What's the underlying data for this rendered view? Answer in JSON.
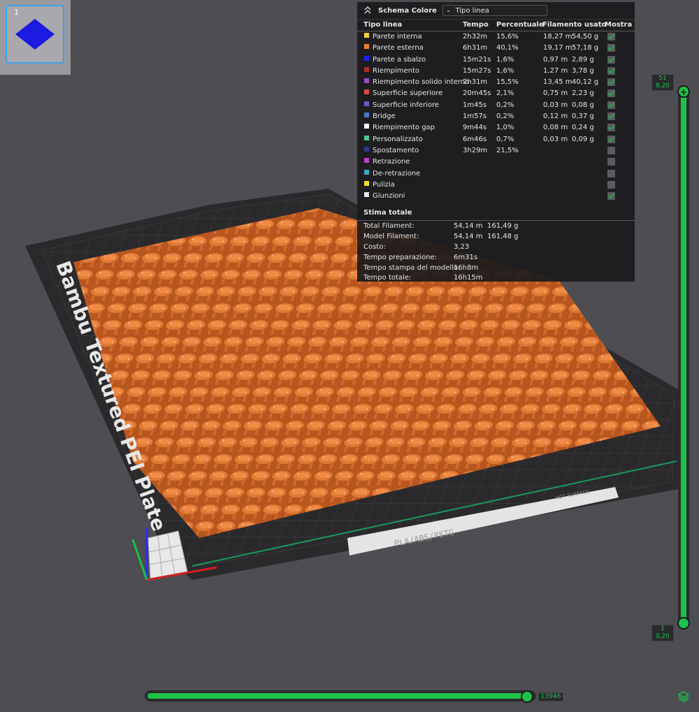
{
  "plate_thumbnail": {
    "number": "1"
  },
  "bed": {
    "plate_name": "Bambu Textured PEI Plate",
    "material_text": "PLA/ABS/PETG",
    "hot_surface": "HOT SURFACE"
  },
  "legend": {
    "title": "Schema Colore",
    "scheme_value": "Tipo linea",
    "columns": [
      "Tipo linea",
      "Tempo",
      "Percentuale",
      "Filamento usato",
      "Mostra"
    ],
    "rows": [
      {
        "color": "#f2d23a",
        "name": "Parete interna",
        "time": "2h32m",
        "percent": "15,6%",
        "length": "18,27 m",
        "weight": "54,50 g",
        "show": true
      },
      {
        "color": "#f07f2c",
        "name": "Parete esterna",
        "time": "6h31m",
        "percent": "40,1%",
        "length": "19,17 m",
        "weight": "57,18 g",
        "show": true
      },
      {
        "color": "#2020ff",
        "name": "Parete a sbalzo",
        "time": "15m21s",
        "percent": "1,6%",
        "length": "0,97 m",
        "weight": "2,89 g",
        "show": true
      },
      {
        "color": "#b03028",
        "name": "Riempimento",
        "time": "15m27s",
        "percent": "1,6%",
        "length": "1,27 m",
        "weight": "3,78 g",
        "show": true
      },
      {
        "color": "#9a4dc8",
        "name": "Riempimento solido interno",
        "time": "2h31m",
        "percent": "15,5%",
        "length": "13,45 m",
        "weight": "40,12 g",
        "show": true
      },
      {
        "color": "#e04848",
        "name": "Superficie superiore",
        "time": "20m45s",
        "percent": "2,1%",
        "length": "0,75 m",
        "weight": "2,23 g",
        "show": true
      },
      {
        "color": "#6a5ac8",
        "name": "Superficie inferiore",
        "time": "1m45s",
        "percent": "0,2%",
        "length": "0,03 m",
        "weight": "0,08 g",
        "show": true
      },
      {
        "color": "#4a78c8",
        "name": "Bridge",
        "time": "1m57s",
        "percent": "0,2%",
        "length": "0,12 m",
        "weight": "0,37 g",
        "show": true
      },
      {
        "color": "#ffffff",
        "name": "Riempimento gap",
        "time": "9m44s",
        "percent": "1,0%",
        "length": "0,08 m",
        "weight": "0,24 g",
        "show": true
      },
      {
        "color": "#4ec88a",
        "name": "Personalizzato",
        "time": "6m46s",
        "percent": "0,7%",
        "length": "0,03 m",
        "weight": "0,09 g",
        "show": true
      },
      {
        "color": "#2a3a8c",
        "name": "Spostamento",
        "time": "3h29m",
        "percent": "21,5%",
        "length": "",
        "weight": "",
        "show": false
      },
      {
        "color": "#c83ad0",
        "name": "Retrazione",
        "time": "",
        "percent": "",
        "length": "",
        "weight": "",
        "show": false
      },
      {
        "color": "#3ab0d0",
        "name": "De-retrazione",
        "time": "",
        "percent": "",
        "length": "",
        "weight": "",
        "show": false
      },
      {
        "color": "#f0e020",
        "name": "Pulizia",
        "time": "",
        "percent": "",
        "length": "",
        "weight": "",
        "show": false
      },
      {
        "color": "#e8e8e8",
        "name": "Giunzioni",
        "time": "",
        "percent": "",
        "length": "",
        "weight": "",
        "show": true
      }
    ],
    "summary_title": "Stima totale",
    "summary": [
      {
        "label": "Total Filament:",
        "v1": "54,14 m",
        "v2": "161,49 g"
      },
      {
        "label": "Model Filament:",
        "v1": "54,14 m",
        "v2": "161,48 g"
      },
      {
        "label": "Costo:",
        "v1": "3,23",
        "v2": ""
      },
      {
        "label": "Tempo preparazione:",
        "v1": "6m31s",
        "v2": ""
      },
      {
        "label": "Tempo stampa del modello:",
        "v1": "16h8m",
        "v2": ""
      },
      {
        "label": "Tempo totale:",
        "v1": "16h15m",
        "v2": ""
      }
    ]
  },
  "layer_slider": {
    "top_layer": "51",
    "top_height": "8,20",
    "bottom_layer": "1",
    "bottom_height": "0,20"
  },
  "move_slider": {
    "value": "13946",
    "position_fraction": 1.0
  },
  "colors": {
    "accent": "#1ec24a",
    "filament": "#d9692a"
  }
}
